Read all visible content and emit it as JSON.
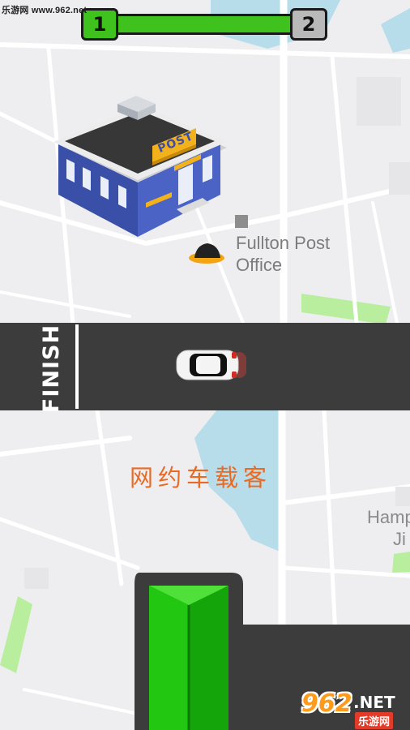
{
  "watermark_top": "乐游网 www.962.net",
  "level": {
    "current": "1",
    "next": "2",
    "progress": 1.0,
    "progress_color": "#3fc21d"
  },
  "building": {
    "sign": "POST",
    "icon": "post-office-building"
  },
  "poi": {
    "name": "Fullton Post Office",
    "line1": "Fullton Post",
    "line2": "Office",
    "icon": "hat-pin-icon"
  },
  "road": {
    "finish_label": "FINISH",
    "color": "#3c3c3c"
  },
  "car": {
    "color": "#ffffff",
    "icon": "taxi-car"
  },
  "caption": "网约车载客",
  "map_labels": {
    "partial_line1": "Hamp",
    "partial_line2": "Ji"
  },
  "start_pad": {
    "color": "#22c712"
  },
  "watermark_bottom": {
    "big": "962",
    "net": ".NET",
    "sub": "乐游网"
  },
  "colors": {
    "background": "#eeeef0",
    "water": "#b7dcea",
    "park": "#b9ee9f",
    "road": "#3c3c3c",
    "green_bar": "#3fc21d",
    "caption": "#e96a23"
  }
}
